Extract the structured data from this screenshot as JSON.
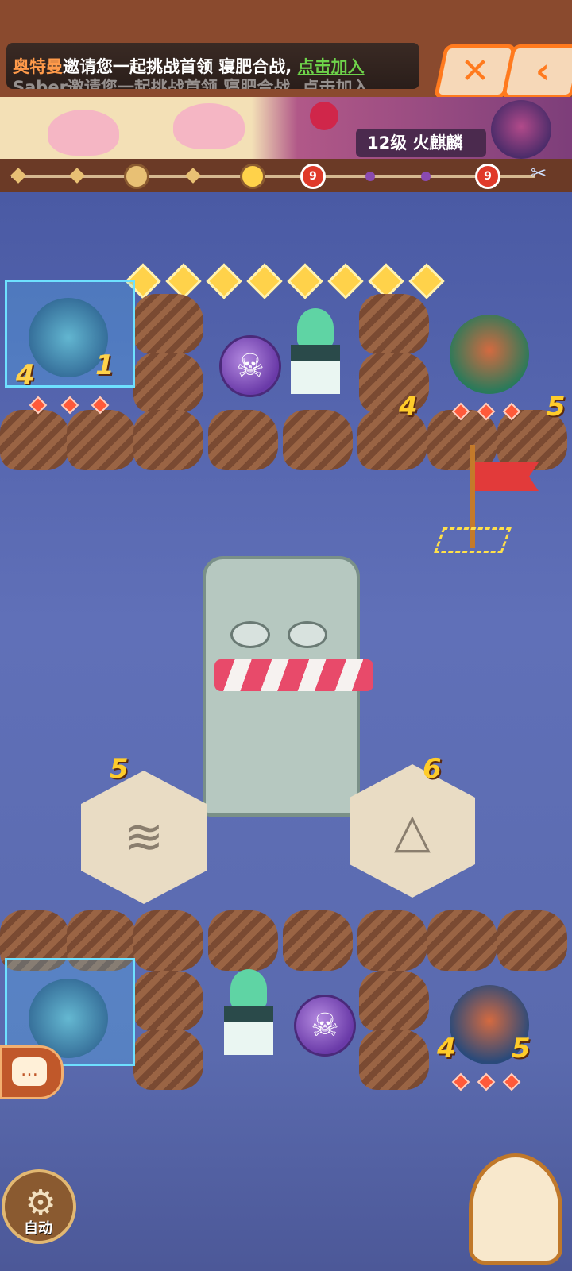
{
  "invite": {
    "inviter": "奥特曼",
    "message": "邀请您一起挑战首领 寝肥合战,",
    "join_label": "点击加入",
    "ghost_line": "Saber邀请您一起挑战首领 寝肥合战, 点击加入"
  },
  "top_buttons": {
    "close_icon": "close-icon",
    "back_icon": "back-arrow-icon"
  },
  "boss": {
    "label": "12级 火麒麟"
  },
  "progress": {
    "nodes": [
      "node",
      "node",
      "stage",
      "node",
      "current",
      "boss",
      "node",
      "boss"
    ],
    "boss_marker": "9"
  },
  "board": {
    "top_gem_count": 8,
    "top_ghost_numbers": [
      "4",
      "1"
    ],
    "top_monster_number": "4",
    "top_monster_extra_number": "5",
    "top_monster_hearts": 3,
    "bottom_monster_numbers": [
      "4",
      "5"
    ],
    "bottom_monster_hearts": 3,
    "hex_left_number": "5",
    "hex_right_number": "6"
  },
  "controls": {
    "auto_label": "自动",
    "chat_icon": "chat-bubble-icon",
    "gear_icon": "gear-icon"
  },
  "colors": {
    "accent_orange": "#ff7a1e",
    "gem_yellow": "#ffd24a",
    "board_blue": "#5a6aae"
  }
}
